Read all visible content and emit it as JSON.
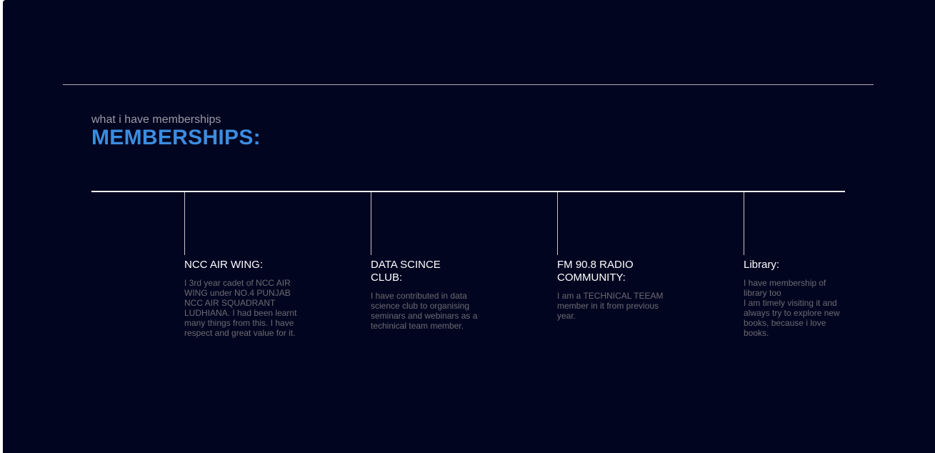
{
  "section": {
    "subtitle": "what i have memberships",
    "title": "MEMBERSHIPS:"
  },
  "memberships": [
    {
      "title": "NCC AIR WING:",
      "description": "I 3rd year cadet of NCC AIR WING under NO.4 PUNJAB NCC AIR SQUADRANT LUDHIANA. I had been learnt many things from this. I have respect and great value for it."
    },
    {
      "title": "DATA SCINCE CLUB:",
      "description": "I have contributed in data science club to organising seminars and webinars as a techinical team member."
    },
    {
      "title": "FM 90.8 RADIO COMMUNITY:",
      "description": "I am a TECHNICAL TEEAM member in it from previous year."
    },
    {
      "title": "Library:",
      "description": "I have membership of library too\nI am timely visiting it and always try to explore new books, because i love books."
    }
  ],
  "colors": {
    "background": "#020520",
    "accent": "#3b8de0",
    "rule": "#b9a6b6"
  }
}
